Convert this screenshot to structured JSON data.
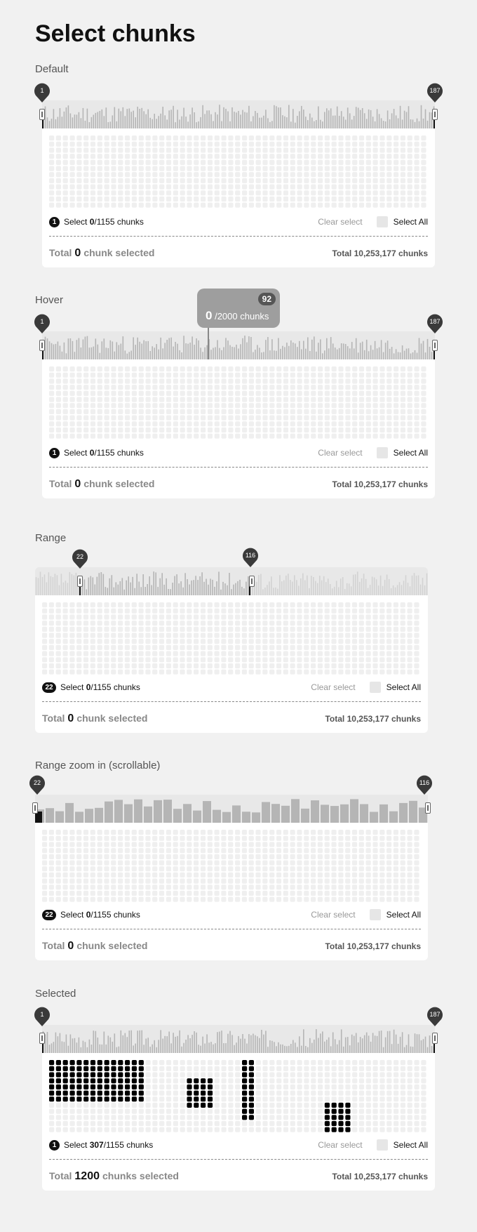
{
  "page": {
    "title": "Select chunks"
  },
  "common": {
    "chunks_total": "1155",
    "clear_label": "Clear select",
    "select_all_label": "Select All",
    "total_prefix": "Total",
    "total_chunks_right": "Total 10,253,177 chunks"
  },
  "sections": [
    {
      "label": "Default",
      "pin_left": "1",
      "pin_right": "187",
      "badge": "1",
      "selected_count": "0",
      "total_count": "0",
      "total_suffix": "chunk selected"
    },
    {
      "label": "Hover",
      "pin_left": "1",
      "pin_right": "187",
      "badge": "1",
      "selected_count": "0",
      "total_count": "0",
      "total_suffix": "chunk selected",
      "tooltip": {
        "badge": "92",
        "value": "0",
        "suffix": "/2000 chunks"
      }
    },
    {
      "label": "Range",
      "pin_left": "22",
      "pin_right": "116",
      "badge": "22",
      "selected_count": "0",
      "total_count": "0",
      "total_suffix": "chunk selected"
    },
    {
      "label": "Range zoom in (scrollable)",
      "pin_left": "22",
      "pin_right": "116",
      "badge": "22",
      "selected_count": "0",
      "total_count": "0",
      "total_suffix": "chunk selected"
    },
    {
      "label": "Selected",
      "pin_left": "1",
      "pin_right": "187",
      "badge": "1",
      "selected_count": "307",
      "total_count": "1200",
      "total_suffix": "chunks selected"
    }
  ],
  "colors": {
    "background": "#f1f1f1",
    "bar": "#bdbdbd",
    "cell_empty": "#efefef",
    "cell_selected": "#000000",
    "pin": "#3a3a3a"
  }
}
